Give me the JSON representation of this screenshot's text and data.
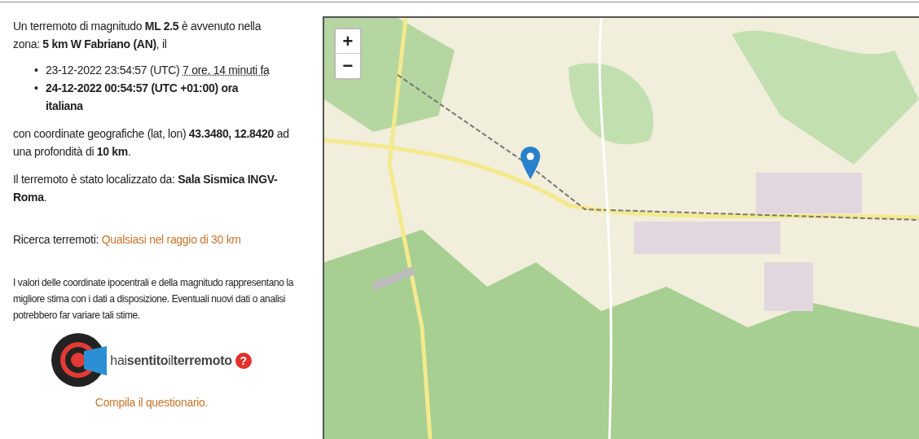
{
  "intro": "Un terremoto di magnitudo **ML 2.5** è avvenuto nella zona: **5 km W Fabriano (AN)**, il",
  "times": [
    {
      "marker": "•",
      "text": "23-12-2022 23:54:57 (UTC)",
      "ago": "7 ore, 14 minuti fa"
    },
    {
      "marker": "•",
      "text": "**24-12-2022 00:54:57 (UTC +01:00) ora italiana**"
    }
  ],
  "coords": "con coordinate geografiche (lat, lon) **43.3480, 12.8420** ad una profondità di **10 km**.",
  "located": "Il terremoto è stato localizzato da: **Sala Sismica INGV-Roma**.",
  "search": {
    "label": "Ricerca terremoti:",
    "link": "Qualsiasi nel raggio di 30 km"
  },
  "disclaimer": "I valori delle coordinate ipocentrali e della magnitudo rappresentano la migliore stima con i dati a disposizione. Eventuali nuovi dati o analisi potrebbero far variare tali stime.",
  "hst": {
    "logo_text": "hai**sentito**il**terremoto**",
    "help": "?",
    "link": "Compila il questionario."
  },
  "map": {
    "zoom_in": "+",
    "zoom_out": "−"
  }
}
